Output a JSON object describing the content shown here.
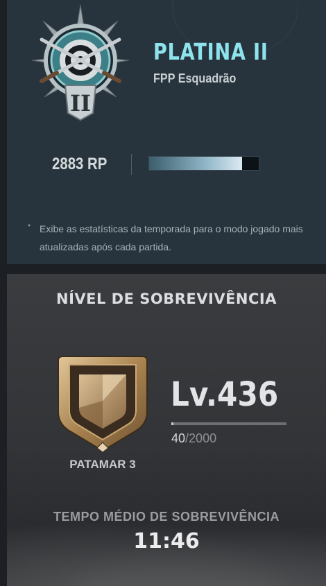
{
  "rank": {
    "title": "PLATINA II",
    "mode": "FPP Esquadrão",
    "rp_text": "2883 RP",
    "rp_progress": 0.85,
    "badge_numeral": "II",
    "note": "Exibe as estatísticas da temporada para o modo jogado mais atualizadas após cada partida.",
    "colors": {
      "title": "#8ee3ec",
      "panel": "#27343d"
    }
  },
  "survival": {
    "title": "NÍVEL DE SOBREVIVÊNCIA",
    "tier": "PATAMAR 3",
    "level": "Lv.436",
    "xp_current": "40",
    "xp_separator": "/",
    "xp_max": "2000",
    "xp_progress": 0.02,
    "avg_label": "TEMPO MÉDIO DE SOBREVIVÊNCIA",
    "avg_value": "11:46"
  }
}
